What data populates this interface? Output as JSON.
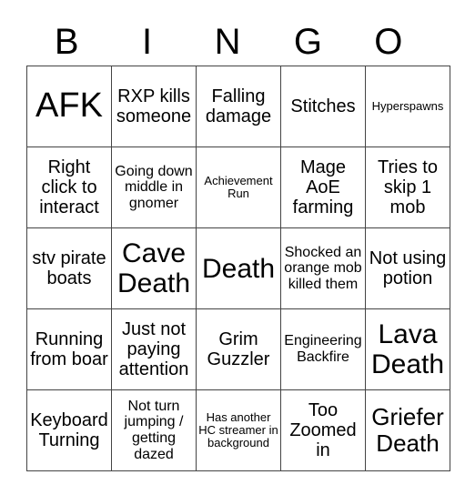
{
  "header": [
    "B",
    "I",
    "N",
    "G",
    "O"
  ],
  "cells": [
    [
      {
        "text": "AFK",
        "size": "s36"
      },
      {
        "text": "RXP kills someone",
        "size": "s18"
      },
      {
        "text": "Falling damage",
        "size": "s18"
      },
      {
        "text": "Stitches",
        "size": "s18"
      },
      {
        "text": "Hyperspawns",
        "size": "s9"
      }
    ],
    [
      {
        "text": "Right click to interact",
        "size": "s18"
      },
      {
        "text": "Going down middle in gnomer",
        "size": "s13"
      },
      {
        "text": "Achievement Run",
        "size": "s9"
      },
      {
        "text": "Mage AoE farming",
        "size": "s18"
      },
      {
        "text": "Tries to skip 1 mob",
        "size": "s18"
      }
    ],
    [
      {
        "text": "stv pirate boats",
        "size": "s18"
      },
      {
        "text": "Cave Death",
        "size": "s28"
      },
      {
        "text": "Death",
        "size": "s28"
      },
      {
        "text": "Shocked an orange mob killed them",
        "size": "s13"
      },
      {
        "text": "Not using potion",
        "size": "s18"
      }
    ],
    [
      {
        "text": "Running from boar",
        "size": "s18"
      },
      {
        "text": "Just not paying attention",
        "size": "s18"
      },
      {
        "text": "Grim Guzzler",
        "size": "s18"
      },
      {
        "text": "Engineering Backfire",
        "size": "s13"
      },
      {
        "text": "Lava Death",
        "size": "s28"
      }
    ],
    [
      {
        "text": "Keyboard Turning",
        "size": "s18"
      },
      {
        "text": "Not turn jumping / getting dazed",
        "size": "s13"
      },
      {
        "text": "Has another HC streamer in background",
        "size": "s9"
      },
      {
        "text": "Too Zoomed in",
        "size": "s18"
      },
      {
        "text": "Griefer Death",
        "size": "s24"
      }
    ]
  ]
}
